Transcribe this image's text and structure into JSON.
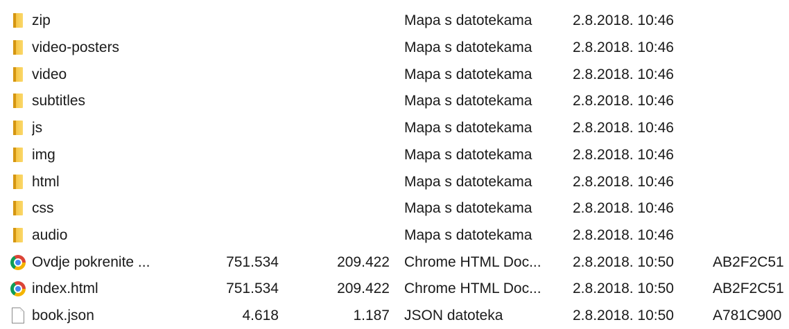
{
  "file_list": {
    "rows": [
      {
        "icon": "folder-icon",
        "name": "zip",
        "size": "",
        "packed": "",
        "type": "Mapa s datotekama",
        "modified": "2.8.2018. 10:46",
        "crc": ""
      },
      {
        "icon": "folder-icon",
        "name": "video-posters",
        "size": "",
        "packed": "",
        "type": "Mapa s datotekama",
        "modified": "2.8.2018. 10:46",
        "crc": ""
      },
      {
        "icon": "folder-icon",
        "name": "video",
        "size": "",
        "packed": "",
        "type": "Mapa s datotekama",
        "modified": "2.8.2018. 10:46",
        "crc": ""
      },
      {
        "icon": "folder-icon",
        "name": "subtitles",
        "size": "",
        "packed": "",
        "type": "Mapa s datotekama",
        "modified": "2.8.2018. 10:46",
        "crc": ""
      },
      {
        "icon": "folder-icon",
        "name": "js",
        "size": "",
        "packed": "",
        "type": "Mapa s datotekama",
        "modified": "2.8.2018. 10:46",
        "crc": ""
      },
      {
        "icon": "folder-icon",
        "name": "img",
        "size": "",
        "packed": "",
        "type": "Mapa s datotekama",
        "modified": "2.8.2018. 10:46",
        "crc": ""
      },
      {
        "icon": "folder-icon",
        "name": "html",
        "size": "",
        "packed": "",
        "type": "Mapa s datotekama",
        "modified": "2.8.2018. 10:46",
        "crc": ""
      },
      {
        "icon": "folder-icon",
        "name": "css",
        "size": "",
        "packed": "",
        "type": "Mapa s datotekama",
        "modified": "2.8.2018. 10:46",
        "crc": ""
      },
      {
        "icon": "folder-icon",
        "name": "audio",
        "size": "",
        "packed": "",
        "type": "Mapa s datotekama",
        "modified": "2.8.2018. 10:46",
        "crc": ""
      },
      {
        "icon": "chrome-icon",
        "name": "Ovdje pokrenite ...",
        "size": "751.534",
        "packed": "209.422",
        "type": "Chrome HTML Doc...",
        "modified": "2.8.2018. 10:50",
        "crc": "AB2F2C51"
      },
      {
        "icon": "chrome-icon",
        "name": "index.html",
        "size": "751.534",
        "packed": "209.422",
        "type": "Chrome HTML Doc...",
        "modified": "2.8.2018. 10:50",
        "crc": "AB2F2C51"
      },
      {
        "icon": "file-icon",
        "name": "book.json",
        "size": "4.618",
        "packed": "1.187",
        "type": "JSON datoteka",
        "modified": "2.8.2018. 10:50",
        "crc": "A781C900"
      }
    ]
  }
}
